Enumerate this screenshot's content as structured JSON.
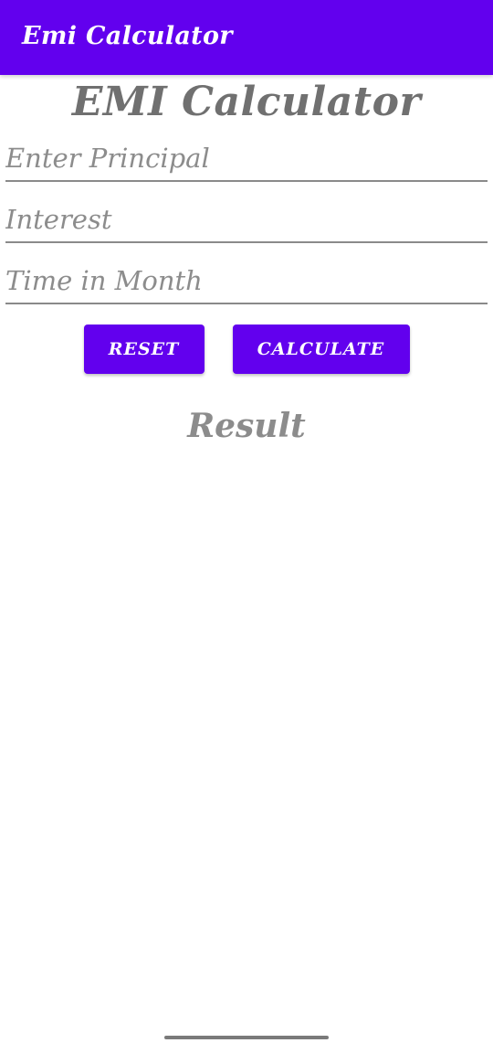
{
  "appbar": {
    "title": "Emi Calculator",
    "color": "#6200EE"
  },
  "main": {
    "title": "EMI Calculator",
    "fields": {
      "principal": {
        "value": "",
        "placeholder": "Enter Principal"
      },
      "interest": {
        "value": "",
        "placeholder": "Interest"
      },
      "time": {
        "value": "",
        "placeholder": "Time in Month"
      }
    },
    "buttons": {
      "reset_label": "RESET",
      "calculate_label": "CALCULATE"
    },
    "result_label": "Result"
  },
  "nav": {
    "handle_icon": "gesture-nav-handle-icon"
  }
}
